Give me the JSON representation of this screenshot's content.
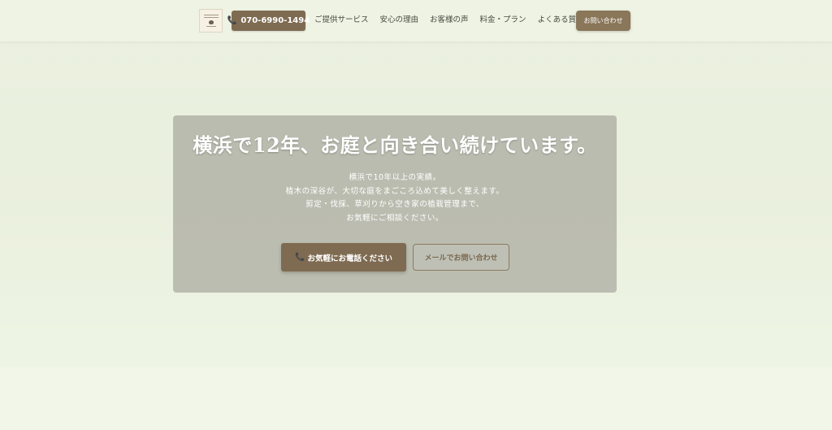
{
  "header": {
    "phone_label": "070-6990-1494",
    "nav_items": [
      {
        "label": "ご提供サービス"
      },
      {
        "label": "安心の理由"
      },
      {
        "label": "お客様の声"
      },
      {
        "label": "料金・プラン"
      },
      {
        "label": "よくある質問"
      }
    ],
    "contact_label": "お問い合わせ"
  },
  "hero": {
    "title": "横浜で12年、お庭と向き合い続けています。",
    "lines": [
      "横浜で10年以上の実績。",
      "植木の深谷が、大切な庭をまごころ込めて美しく整えます。",
      "剪定・伐採、草刈りから空き家の植栽管理まで、",
      "お気軽にご相談ください。"
    ],
    "call_label": "お気軽にお電話ください",
    "mail_label": "メールでお問い合わせ"
  },
  "icons": {
    "phone": "phone-icon",
    "logo": "logo-icon"
  },
  "colors": {
    "accent_brown": "#7e6b51",
    "background": "#eef3e3",
    "hero_overlay": "#9e9c94"
  }
}
